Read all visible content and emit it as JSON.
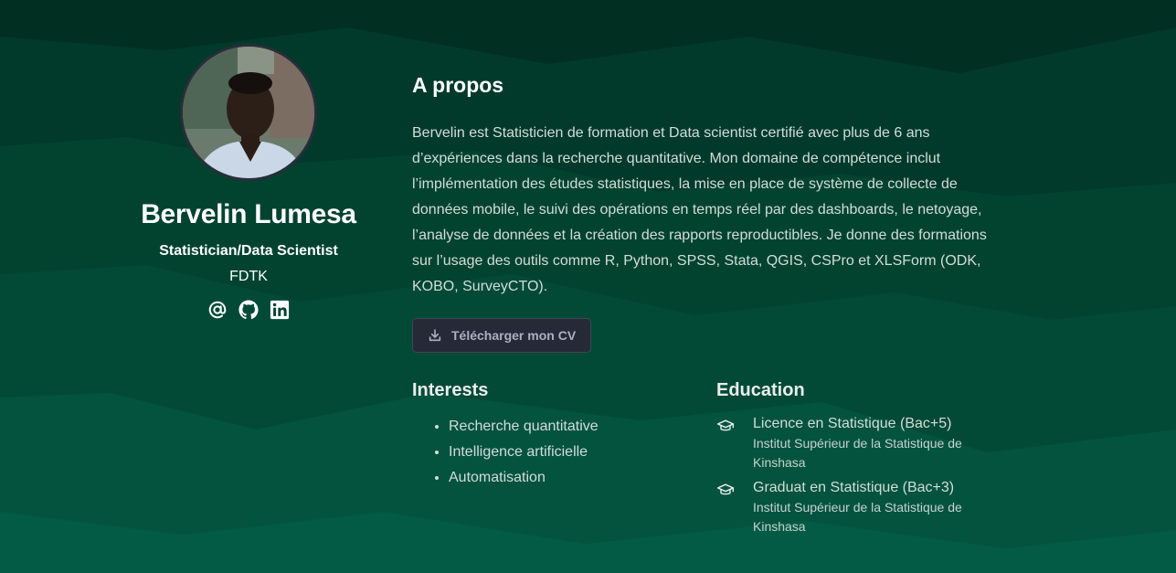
{
  "profile": {
    "name": "Bervelin Lumesa",
    "role": "Statistician/Data Scientist",
    "organization": "FDTK",
    "socials": [
      {
        "icon": "at-icon"
      },
      {
        "icon": "github-icon"
      },
      {
        "icon": "linkedin-icon"
      }
    ]
  },
  "about": {
    "title": "A propos",
    "bio": "Bervelin est Statisticien de formation et Data scientist certifié avec plus de 6 ans d’expériences dans la recherche quantitative. Mon domaine de compétence inclut l’implémentation des études statistiques, la mise en place de système de collecte de données mobile, le suivi des opérations en temps réel par des dashboards, le netoyage, l’analyse de données et la création des rapports reproductibles. Je donne des formations sur l’usage des outils comme R, Python, SPSS, Stata, QGIS, CSPro et XLSForm (ODK, KOBO, SurveyCTO).",
    "cv_button": "Télécharger mon CV",
    "cv_icon": "download-icon"
  },
  "interests": {
    "title": "Interests",
    "items": [
      "Recherche quantitative",
      "Intelligence artificielle",
      "Automatisation"
    ]
  },
  "education": {
    "title": "Education",
    "icon": "graduation-cap-icon",
    "items": [
      {
        "degree": "Licence en Statistique (Bac+5)",
        "institution": "Institut Supérieur de la Statistique de Kinshasa"
      },
      {
        "degree": "Graduat en Statistique (Bac+3)",
        "institution": "Institut Supérieur de la Statistique de Kinshasa"
      }
    ]
  },
  "colors": {
    "background_dark": "#012a1e",
    "background_mid": "#024a35",
    "background_light": "#03594a",
    "button_bg": "#262a37",
    "text_primary": "#ffffff"
  }
}
